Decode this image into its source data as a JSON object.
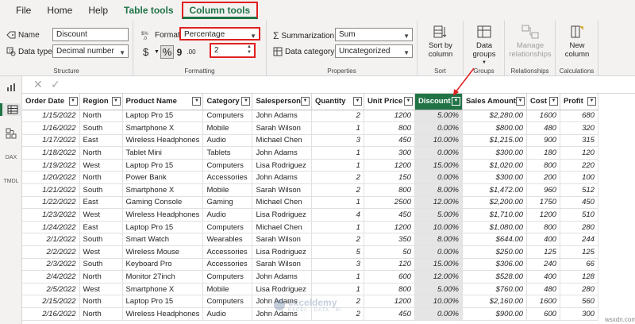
{
  "menu": {
    "tabs": [
      "File",
      "Home",
      "Help",
      "Table tools",
      "Column tools"
    ]
  },
  "ribbon": {
    "structure": {
      "name_label": "Name",
      "name_value": "Discount",
      "datatype_label": "Data type",
      "datatype_value": "Decimal number",
      "group_label": "Structure"
    },
    "formatting": {
      "format_label": "Format",
      "format_value": "Percentage",
      "currency_symbol": "$",
      "percent_symbol": "%",
      "comma_symbol": "9",
      "decimals_symbol": ".00",
      "decimals_value": "2",
      "group_label": "Formatting"
    },
    "properties": {
      "summarization_label": "Summarization",
      "summarization_value": "Sum",
      "category_label": "Data category",
      "category_value": "Uncategorized",
      "group_label": "Properties"
    },
    "sort": {
      "button_label": "Sort by column",
      "group_label": "Sort"
    },
    "groups": {
      "button_label": "Data groups",
      "group_label": "Groups"
    },
    "relationships": {
      "button_label": "Manage relationships",
      "group_label": "Relationships"
    },
    "calculations": {
      "button_label": "New column",
      "group_label": "Calculations"
    }
  },
  "leftbar": {
    "icons": [
      "report-view-icon",
      "table-view-icon",
      "model-view-icon",
      "dax-query-icon",
      "tmdl-view-icon"
    ],
    "dax_text": "DAX",
    "tmdl_text": "TMDL"
  },
  "formula_bar": {
    "cancel_glyph": "✕",
    "commit_glyph": "✓"
  },
  "table": {
    "columns": [
      "Order Date",
      "Region",
      "Product Name",
      "Category",
      "Salesperson",
      "Quantity",
      "Unit Price",
      "Discount",
      "Sales Amount",
      "Cost",
      "Profit"
    ],
    "selected_column": "Discount",
    "rows": [
      [
        "1/15/2022",
        "North",
        "Laptop Pro 15",
        "Computers",
        "John Adams",
        "2",
        "1200",
        "5.00%",
        "$2,280.00",
        "1600",
        "680"
      ],
      [
        "1/16/2022",
        "South",
        "Smartphone X",
        "Mobile",
        "Sarah Wilson",
        "1",
        "800",
        "0.00%",
        "$800.00",
        "480",
        "320"
      ],
      [
        "1/17/2022",
        "East",
        "Wireless Headphones",
        "Audio",
        "Michael Chen",
        "3",
        "450",
        "10.00%",
        "$1,215.00",
        "900",
        "315"
      ],
      [
        "1/18/2022",
        "North",
        "Tablet Mini",
        "Tablets",
        "John Adams",
        "1",
        "300",
        "0.00%",
        "$300.00",
        "180",
        "120"
      ],
      [
        "1/19/2022",
        "West",
        "Laptop Pro 15",
        "Computers",
        "Lisa Rodriguez",
        "1",
        "1200",
        "15.00%",
        "$1,020.00",
        "800",
        "220"
      ],
      [
        "1/20/2022",
        "North",
        "Power Bank",
        "Accessories",
        "John Adams",
        "2",
        "150",
        "0.00%",
        "$300.00",
        "200",
        "100"
      ],
      [
        "1/21/2022",
        "South",
        "Smartphone X",
        "Mobile",
        "Sarah Wilson",
        "2",
        "800",
        "8.00%",
        "$1,472.00",
        "960",
        "512"
      ],
      [
        "1/22/2022",
        "East",
        "Gaming Console",
        "Gaming",
        "Michael Chen",
        "1",
        "2500",
        "12.00%",
        "$2,200.00",
        "1750",
        "450"
      ],
      [
        "1/23/2022",
        "West",
        "Wireless Headphones",
        "Audio",
        "Lisa Rodriguez",
        "4",
        "450",
        "5.00%",
        "$1,710.00",
        "1200",
        "510"
      ],
      [
        "1/24/2022",
        "East",
        "Laptop Pro 15",
        "Computers",
        "Michael Chen",
        "1",
        "1200",
        "10.00%",
        "$1,080.00",
        "800",
        "280"
      ],
      [
        "2/1/2022",
        "South",
        "Smart Watch",
        "Wearables",
        "Sarah Wilson",
        "2",
        "350",
        "8.00%",
        "$644.00",
        "400",
        "244"
      ],
      [
        "2/2/2022",
        "West",
        "Wireless Mouse",
        "Accessories",
        "Lisa Rodriguez",
        "5",
        "50",
        "0.00%",
        "$250.00",
        "125",
        "125"
      ],
      [
        "2/3/2022",
        "South",
        "Keyboard Pro",
        "Accessories",
        "Sarah Wilson",
        "3",
        "120",
        "15.00%",
        "$306.00",
        "240",
        "66"
      ],
      [
        "2/4/2022",
        "North",
        "Monitor 27inch",
        "Computers",
        "John Adams",
        "1",
        "600",
        "12.00%",
        "$528.00",
        "400",
        "128"
      ],
      [
        "2/5/2022",
        "West",
        "Smartphone X",
        "Mobile",
        "Lisa Rodriguez",
        "1",
        "800",
        "5.00%",
        "$760.00",
        "480",
        "280"
      ],
      [
        "2/15/2022",
        "North",
        "Laptop Pro 15",
        "Computers",
        "John Adams",
        "2",
        "1200",
        "10.00%",
        "$2,160.00",
        "1600",
        "560"
      ],
      [
        "2/16/2022",
        "North",
        "Wireless Headphones",
        "Audio",
        "John Adams",
        "2",
        "450",
        "0.00%",
        "$900.00",
        "600",
        "300"
      ]
    ]
  },
  "watermark": {
    "name": "exceldemy",
    "tagline": "EXCEL · DATA · BI"
  },
  "corner_logo": "wsxdn.com"
}
